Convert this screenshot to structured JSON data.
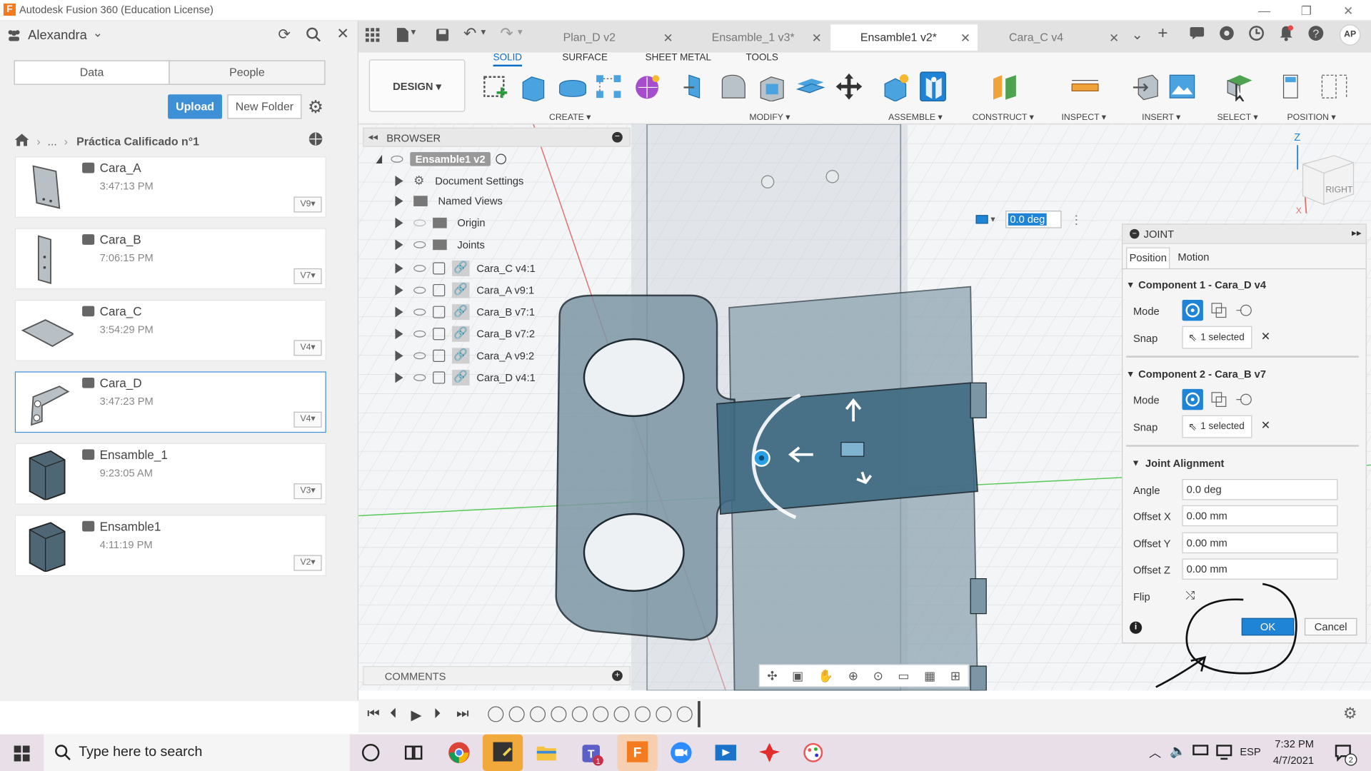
{
  "window": {
    "title": "Autodesk Fusion 360 (Education License)",
    "logo": "F",
    "controls": [
      "—",
      "❐",
      "✕"
    ]
  },
  "data_panel": {
    "user": "Alexandra",
    "tabs": [
      "Data",
      "People"
    ],
    "upload_label": "Upload",
    "new_folder_label": "New Folder",
    "breadcrumb_ellipsis": "...",
    "breadcrumb_current": "Práctica Calificado n°1",
    "items": [
      {
        "name": "Cara_A",
        "time": "3:47:13 PM",
        "version": "V9"
      },
      {
        "name": "Cara_B",
        "time": "7:06:15 PM",
        "version": "V7"
      },
      {
        "name": "Cara_C",
        "time": "3:54:29 PM",
        "version": "V4"
      },
      {
        "name": "Cara_D",
        "time": "3:47:23 PM",
        "version": "V4"
      },
      {
        "name": "Ensamble_1",
        "time": "9:23:05 AM",
        "version": "V3"
      },
      {
        "name": "Ensamble1",
        "time": "4:11:19 PM",
        "version": "V2"
      }
    ]
  },
  "doc_tabs": [
    {
      "label": "Plan_D v2",
      "active": false
    },
    {
      "label": "Ensamble_1 v3*",
      "active": false
    },
    {
      "label": "Ensamble1 v2*",
      "active": true
    },
    {
      "label": "Cara_C v4",
      "active": false
    }
  ],
  "toolbar": {
    "workspace": "DESIGN",
    "tabs": [
      "SOLID",
      "SURFACE",
      "SHEET METAL",
      "TOOLS"
    ],
    "groups": [
      "CREATE",
      "MODIFY",
      "ASSEMBLE",
      "CONSTRUCT",
      "INSPECT",
      "INSERT",
      "SELECT",
      "POSITION"
    ],
    "user_initials": "AP"
  },
  "browser": {
    "title": "BROWSER",
    "root": "Ensamble1 v2",
    "items": [
      "Document Settings",
      "Named Views",
      "Origin",
      "Joints",
      "Cara_C v4:1",
      "Cara_A v9:1",
      "Cara_B v7:1",
      "Cara_B v7:2",
      "Cara_A v9:2",
      "Cara_D v4:1"
    ]
  },
  "angle_input": "0.0 deg",
  "viewcube": {
    "face": "RIGHT",
    "axis_z": "Z",
    "axis_x": "X"
  },
  "joint": {
    "title": "JOINT",
    "tabs": [
      "Position",
      "Motion"
    ],
    "component1": "Component 1 - Cara_D v4",
    "component2": "Component 2 - Cara_B v7",
    "mode_label": "Mode",
    "snap_label": "Snap",
    "snap1": "1 selected",
    "snap2": "1 selected",
    "alignment": "Joint Alignment",
    "angle_label": "Angle",
    "angle": "0.0 deg",
    "offx_label": "Offset X",
    "offx": "0.00 mm",
    "offy_label": "Offset Y",
    "offy": "0.00 mm",
    "offz_label": "Offset Z",
    "offz": "0.00 mm",
    "flip_label": "Flip",
    "ok": "OK",
    "cancel": "Cancel"
  },
  "comments": "COMMENTS",
  "taskbar": {
    "search": "Type here to search",
    "lang": "ESP",
    "time": "7:32 PM",
    "date": "4/7/2021",
    "notifications": "2"
  },
  "colors": {
    "accent": "#0a6cc4",
    "upload": "#3d8fd6",
    "taskbar": "#e8dfe8",
    "model": "#6f8e9f"
  }
}
